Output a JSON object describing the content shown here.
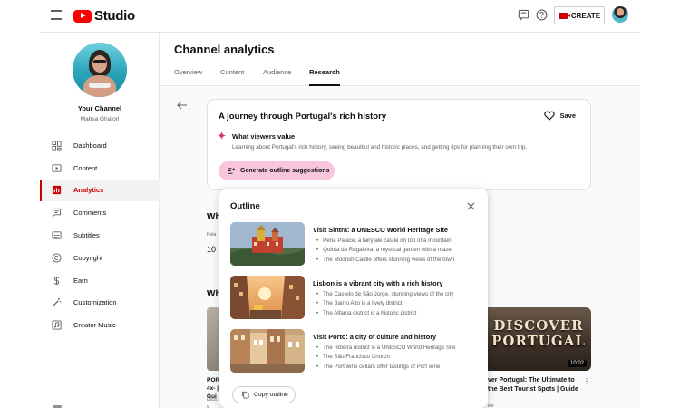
{
  "app": {
    "logo_text": "Studio",
    "create_label": "CREATE"
  },
  "sidebar": {
    "channel_name": "Your Channel",
    "channel_handle": "Mahsa Ghafori",
    "items": [
      {
        "label": "Dashboard",
        "icon": "dashboard-icon",
        "active": false
      },
      {
        "label": "Content",
        "icon": "content-icon",
        "active": false
      },
      {
        "label": "Analytics",
        "icon": "analytics-icon",
        "active": true
      },
      {
        "label": "Comments",
        "icon": "comments-icon",
        "active": false
      },
      {
        "label": "Subtitles",
        "icon": "subtitles-icon",
        "active": false
      },
      {
        "label": "Copyright",
        "icon": "copyright-icon",
        "active": false
      },
      {
        "label": "Earn",
        "icon": "earn-icon",
        "active": false
      },
      {
        "label": "Customization",
        "icon": "customization-icon",
        "active": false
      },
      {
        "label": "Creator Music",
        "icon": "creator-music-icon",
        "active": false
      }
    ]
  },
  "main": {
    "title": "Channel analytics",
    "tabs": [
      {
        "label": "Overview",
        "active": false
      },
      {
        "label": "Content",
        "active": false
      },
      {
        "label": "Audience",
        "active": false
      },
      {
        "label": "Research",
        "active": true
      }
    ]
  },
  "topic": {
    "title": "A journey through Portugal's rich history",
    "save_label": "Save",
    "viewers_heading": "What viewers value",
    "viewers_text": "Learning about Portugal's rich history, seeing beautiful and historic places, and getting tips for planning their own trip.",
    "generate_label": "Generate outline suggestions"
  },
  "background": {
    "heading1": "Wh",
    "small1": "Rela",
    "num1": "10",
    "heading2": "Wh",
    "left_video_title": "POR | 4x- | Gui",
    "left_video_meta": "Luca 3M v",
    "right_video_title": "ver Portugal: The Ultimate to the Best Tourist Spots | Guide",
    "right_video_meta": "ide",
    "thumb_text": "DISCOVER PORTUGAL",
    "thumb_duration": "10:02"
  },
  "outline": {
    "title": "Outline",
    "copy_label": "Copy outline",
    "items": [
      {
        "heading": "Visit Sintra: a UNESCO World Heritage Site",
        "bullets": [
          "Pena Palace, a fairytale castle on top of a mountain",
          "Quinta da Regaleira, a mystical garden with a maze",
          "The Moorish Castle offers stunning views of the town"
        ]
      },
      {
        "heading": "Lisbon is a vibrant city with a rich history",
        "bullets": [
          "The Castelo de São Jorge, stunning views of the city",
          "The Bairro Alto is a lively district",
          "The Alfama district is a historic district"
        ]
      },
      {
        "heading": "Visit Porto: a city of culture and history",
        "bullets": [
          "The Ribeira district is a UNESCO World Heritage Site",
          "The São Francisco Church",
          "The Port wine cellars offer tastings of Port wine"
        ]
      }
    ]
  },
  "colors": {
    "accent": "#cc0000",
    "brand_red": "#ff0000",
    "pink_button": "#f7c6dc",
    "sparkle": "#e0307c"
  }
}
